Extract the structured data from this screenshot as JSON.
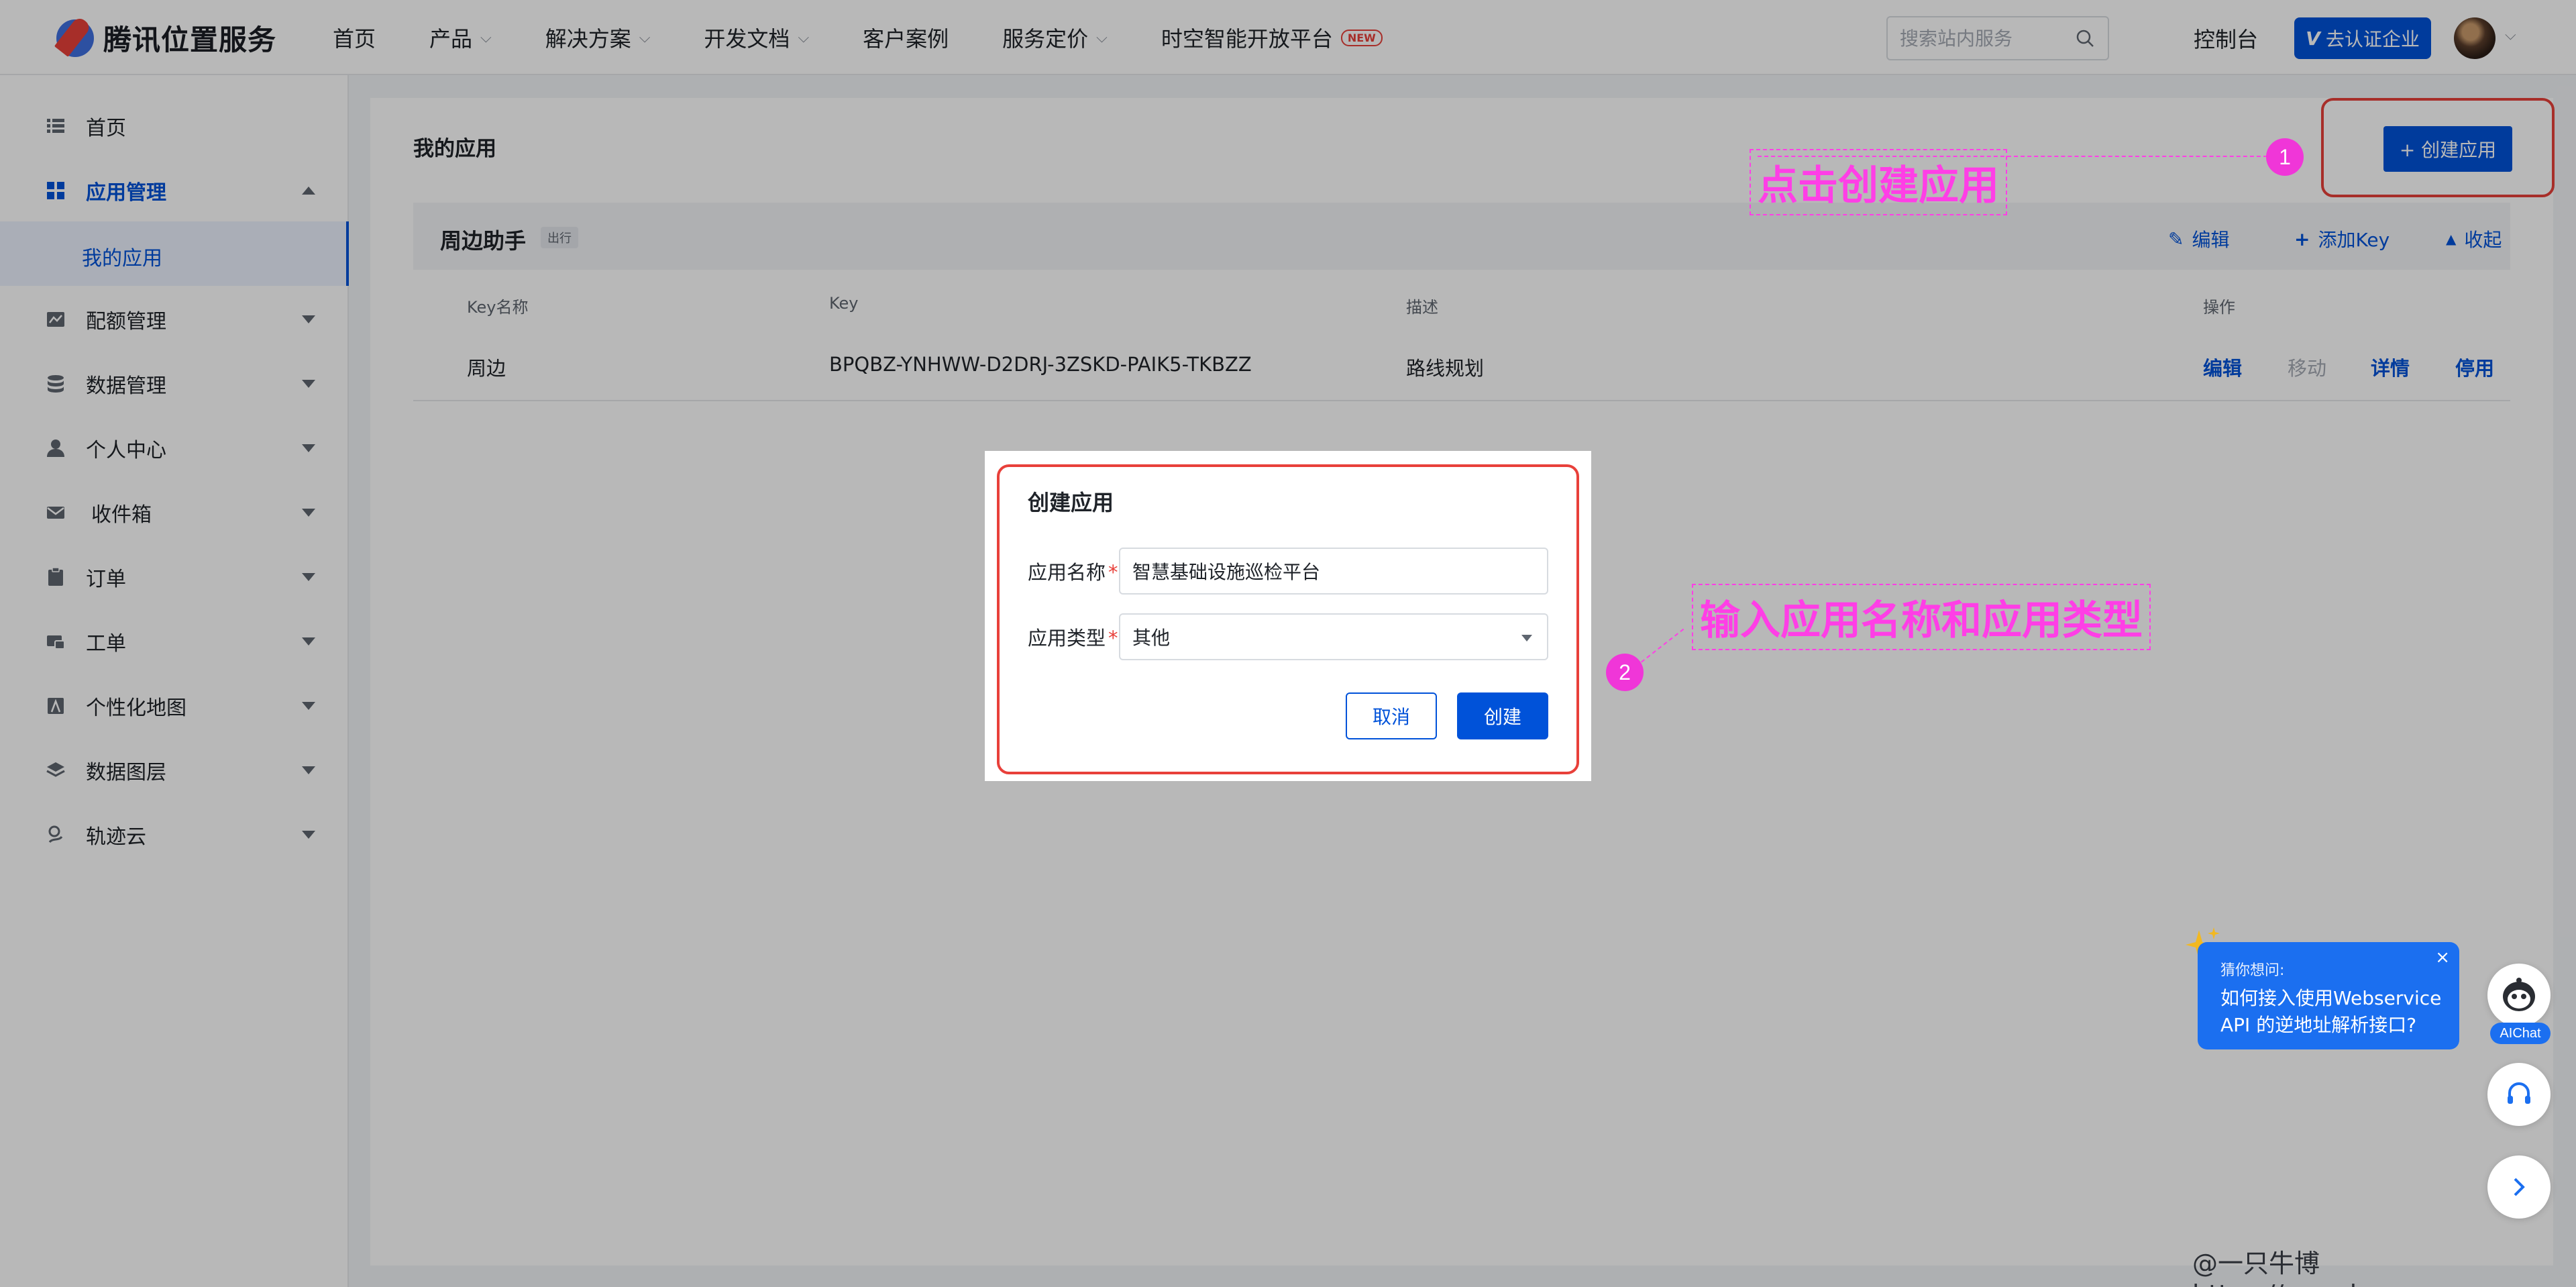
{
  "brand": {
    "name": "腾讯位置服务"
  },
  "nav": {
    "items": [
      {
        "label": "首页",
        "has_dropdown": false
      },
      {
        "label": "产品",
        "has_dropdown": true
      },
      {
        "label": "解决方案",
        "has_dropdown": true
      },
      {
        "label": "开发文档",
        "has_dropdown": true
      },
      {
        "label": "客户案例",
        "has_dropdown": false
      },
      {
        "label": "服务定价",
        "has_dropdown": true
      },
      {
        "label": "时空智能开放平台",
        "has_dropdown": false,
        "badge": "NEW"
      }
    ],
    "search_placeholder": "搜索站内服务",
    "console_label": "控制台",
    "certify_label": "去认证企业"
  },
  "sidebar": {
    "items": [
      {
        "label": "首页",
        "icon": "list-icon"
      },
      {
        "label": "应用管理",
        "icon": "grid-icon",
        "expanded": true,
        "active": true
      },
      {
        "label": "配额管理",
        "icon": "quota-icon"
      },
      {
        "label": "数据管理",
        "icon": "database-icon"
      },
      {
        "label": "个人中心",
        "icon": "user-icon"
      },
      {
        "label": "收件箱",
        "icon": "mail-icon"
      },
      {
        "label": "订单",
        "icon": "clipboard-icon"
      },
      {
        "label": "工单",
        "icon": "ticket-icon"
      },
      {
        "label": "个性化地图",
        "icon": "map-icon"
      },
      {
        "label": "数据图层",
        "icon": "layers-icon"
      },
      {
        "label": "轨迹云",
        "icon": "track-icon"
      }
    ],
    "sub_item": "我的应用"
  },
  "main": {
    "title": "我的应用",
    "create_button": "+ 创建应用",
    "app": {
      "name": "周边助手",
      "tag": "出行",
      "actions": {
        "edit": "编辑",
        "add_key": "添加Key",
        "collapse": "收起"
      },
      "columns": [
        "Key名称",
        "Key",
        "描述",
        "操作"
      ],
      "rows": [
        {
          "name": "周边",
          "key": "BPQBZ-YNHWW-D2DRJ-3ZSKD-PAIK5-TKBZZ",
          "desc": "路线规划",
          "ops": {
            "edit": "编辑",
            "move": "移动",
            "detail": "详情",
            "disable": "停用"
          }
        }
      ]
    }
  },
  "modal": {
    "title": "创建应用",
    "name_label": "应用名称",
    "name_value": "智慧基础设施巡检平台",
    "type_label": "应用类型",
    "type_value": "其他",
    "required_mark": "*",
    "cancel": "取消",
    "create": "创建"
  },
  "annotations": {
    "step1_num": "1",
    "step1_text": "点击创建应用",
    "step2_num": "2",
    "step2_text": "输入应用名称和应用类型"
  },
  "aichat": {
    "question_prefix": "猜你想问:",
    "question": "如何接入使用Webservice API 的逆地址解析接口?",
    "close": "×",
    "label": "AIChat"
  },
  "watermark": "@一只牛博 https://acowbo.com",
  "colors": {
    "primary": "#0052d9",
    "annotation": "#ff3ee6",
    "highlight_frame": "#e8403a"
  }
}
